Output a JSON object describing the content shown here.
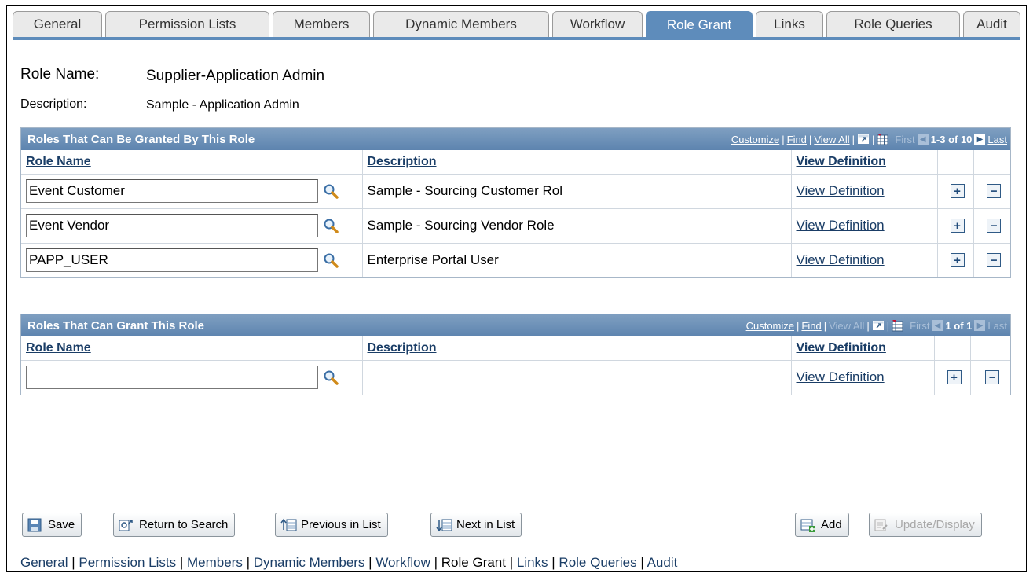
{
  "tabs": [
    "General",
    "Permission Lists",
    "Members",
    "Dynamic Members",
    "Workflow",
    "Role Grant",
    "Links",
    "Role Queries",
    "Audit"
  ],
  "active_tab": "Role Grant",
  "role_name_label": "Role Name:",
  "role_name_value": "Supplier-Application Admin",
  "description_label": "Description:",
  "description_value": "Sample - Application Admin",
  "grid1": {
    "title": "Roles That Can Be Granted By This Role",
    "customize": "Customize",
    "find": "Find",
    "view_all": "View All",
    "first": "First",
    "range": "1-3 of 10",
    "last": "Last",
    "columns": [
      "Role Name",
      "Description",
      "View Definition"
    ],
    "rows": [
      {
        "role": "Event Customer",
        "description": "Sample - Sourcing Customer Rol",
        "link": "View Definition"
      },
      {
        "role": "Event Vendor",
        "description": "Sample - Sourcing Vendor Role",
        "link": "View Definition"
      },
      {
        "role": "PAPP_USER",
        "description": "Enterprise Portal User",
        "link": "View Definition"
      }
    ]
  },
  "grid2": {
    "title": "Roles That Can Grant This Role",
    "customize": "Customize",
    "find": "Find",
    "view_all": "View All",
    "first": "First",
    "range": "1 of 1",
    "last": "Last",
    "columns": [
      "Role Name",
      "Description",
      "View Definition"
    ],
    "rows": [
      {
        "role": "",
        "description": "",
        "link": "View Definition"
      }
    ]
  },
  "buttons": {
    "save": "Save",
    "return": "Return to Search",
    "previous": "Previous in List",
    "next": "Next in List",
    "add": "Add",
    "update": "Update/Display"
  },
  "footer": {
    "links": [
      "General",
      "Permission Lists",
      "Members",
      "Dynamic Members",
      "Workflow",
      "Role Grant",
      "Links",
      "Role Queries",
      "Audit"
    ],
    "current": "Role Grant"
  }
}
